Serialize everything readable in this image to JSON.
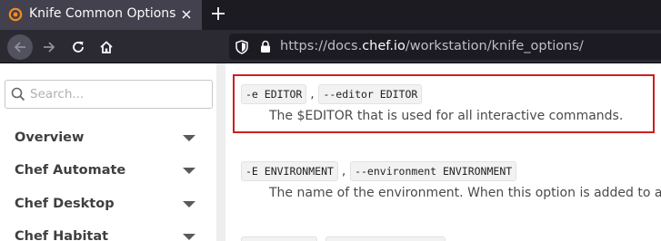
{
  "browser": {
    "tab": {
      "title": "Knife Common Options"
    },
    "url": {
      "prefix": "https://docs.",
      "host": "chef.io",
      "path": "/workstation/knife_options/"
    }
  },
  "sidebar": {
    "search": {
      "placeholder": "Search..."
    },
    "items": [
      {
        "label": "Overview"
      },
      {
        "label": "Chef Automate"
      },
      {
        "label": "Chef Desktop"
      },
      {
        "label": "Chef Habitat"
      }
    ]
  },
  "content": {
    "options": [
      {
        "short": "-e EDITOR",
        "separator": ",",
        "long": "--editor EDITOR",
        "description": "The $EDITOR that is used for all interactive commands."
      },
      {
        "short": "-E ENVIRONMENT",
        "separator": ",",
        "long": "--environment ENVIRONMENT",
        "description": "The name of the environment. When this option is added to a"
      }
    ]
  },
  "colors": {
    "highlight_border": "#cc1f1f",
    "tab_bg": "#42414d",
    "chrome_bg": "#2b2a33"
  }
}
